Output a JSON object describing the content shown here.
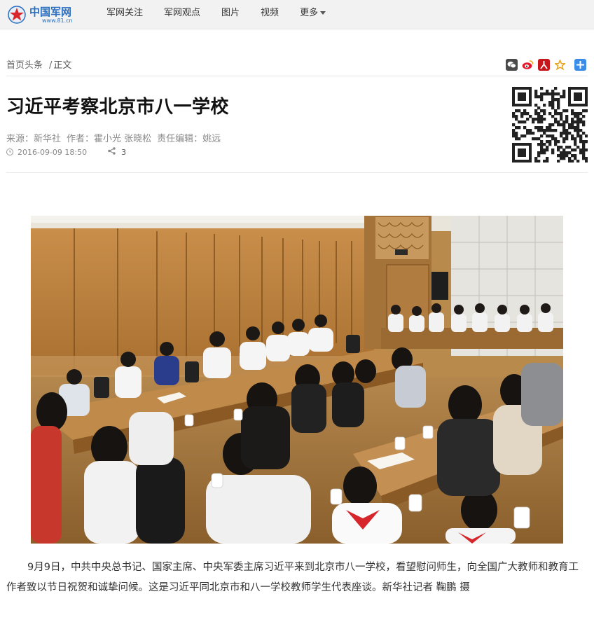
{
  "site": {
    "logo_text": "中国军网",
    "logo_url": "www.81.cn"
  },
  "nav": {
    "items": [
      {
        "label": "军网关注"
      },
      {
        "label": "军网观点"
      },
      {
        "label": "图片"
      },
      {
        "label": "视频"
      },
      {
        "label": "更多"
      }
    ]
  },
  "breadcrumb": {
    "home": "首页头条",
    "separator": "/",
    "current": "正文"
  },
  "share_icons": [
    "wechat-icon",
    "weibo-icon",
    "renren-icon",
    "favorite-star-icon",
    "more-share-icon"
  ],
  "article": {
    "title": "习近平考察北京市八一学校",
    "source": "来源：新华社",
    "author": "作者：霍小光 张晓松",
    "editor": "责任编辑：姚远",
    "datetime": "2016-09-09 18:50",
    "share_count": "3",
    "caption": "9月9日，中共中央总书记、国家主席、中央军委主席习近平来到北京市八一学校，看望慰问师生，向全国广大教师和教育工作者致以节日祝贺和诚挚问候。这是习近平同北京市和八一学校教师学生代表座谈。新华社记者 鞠鹏 摄"
  },
  "colors": {
    "brand_blue": "#2a6fc0",
    "nav_bg": "#f2f2f2",
    "title": "#111111",
    "meta": "#888888"
  }
}
